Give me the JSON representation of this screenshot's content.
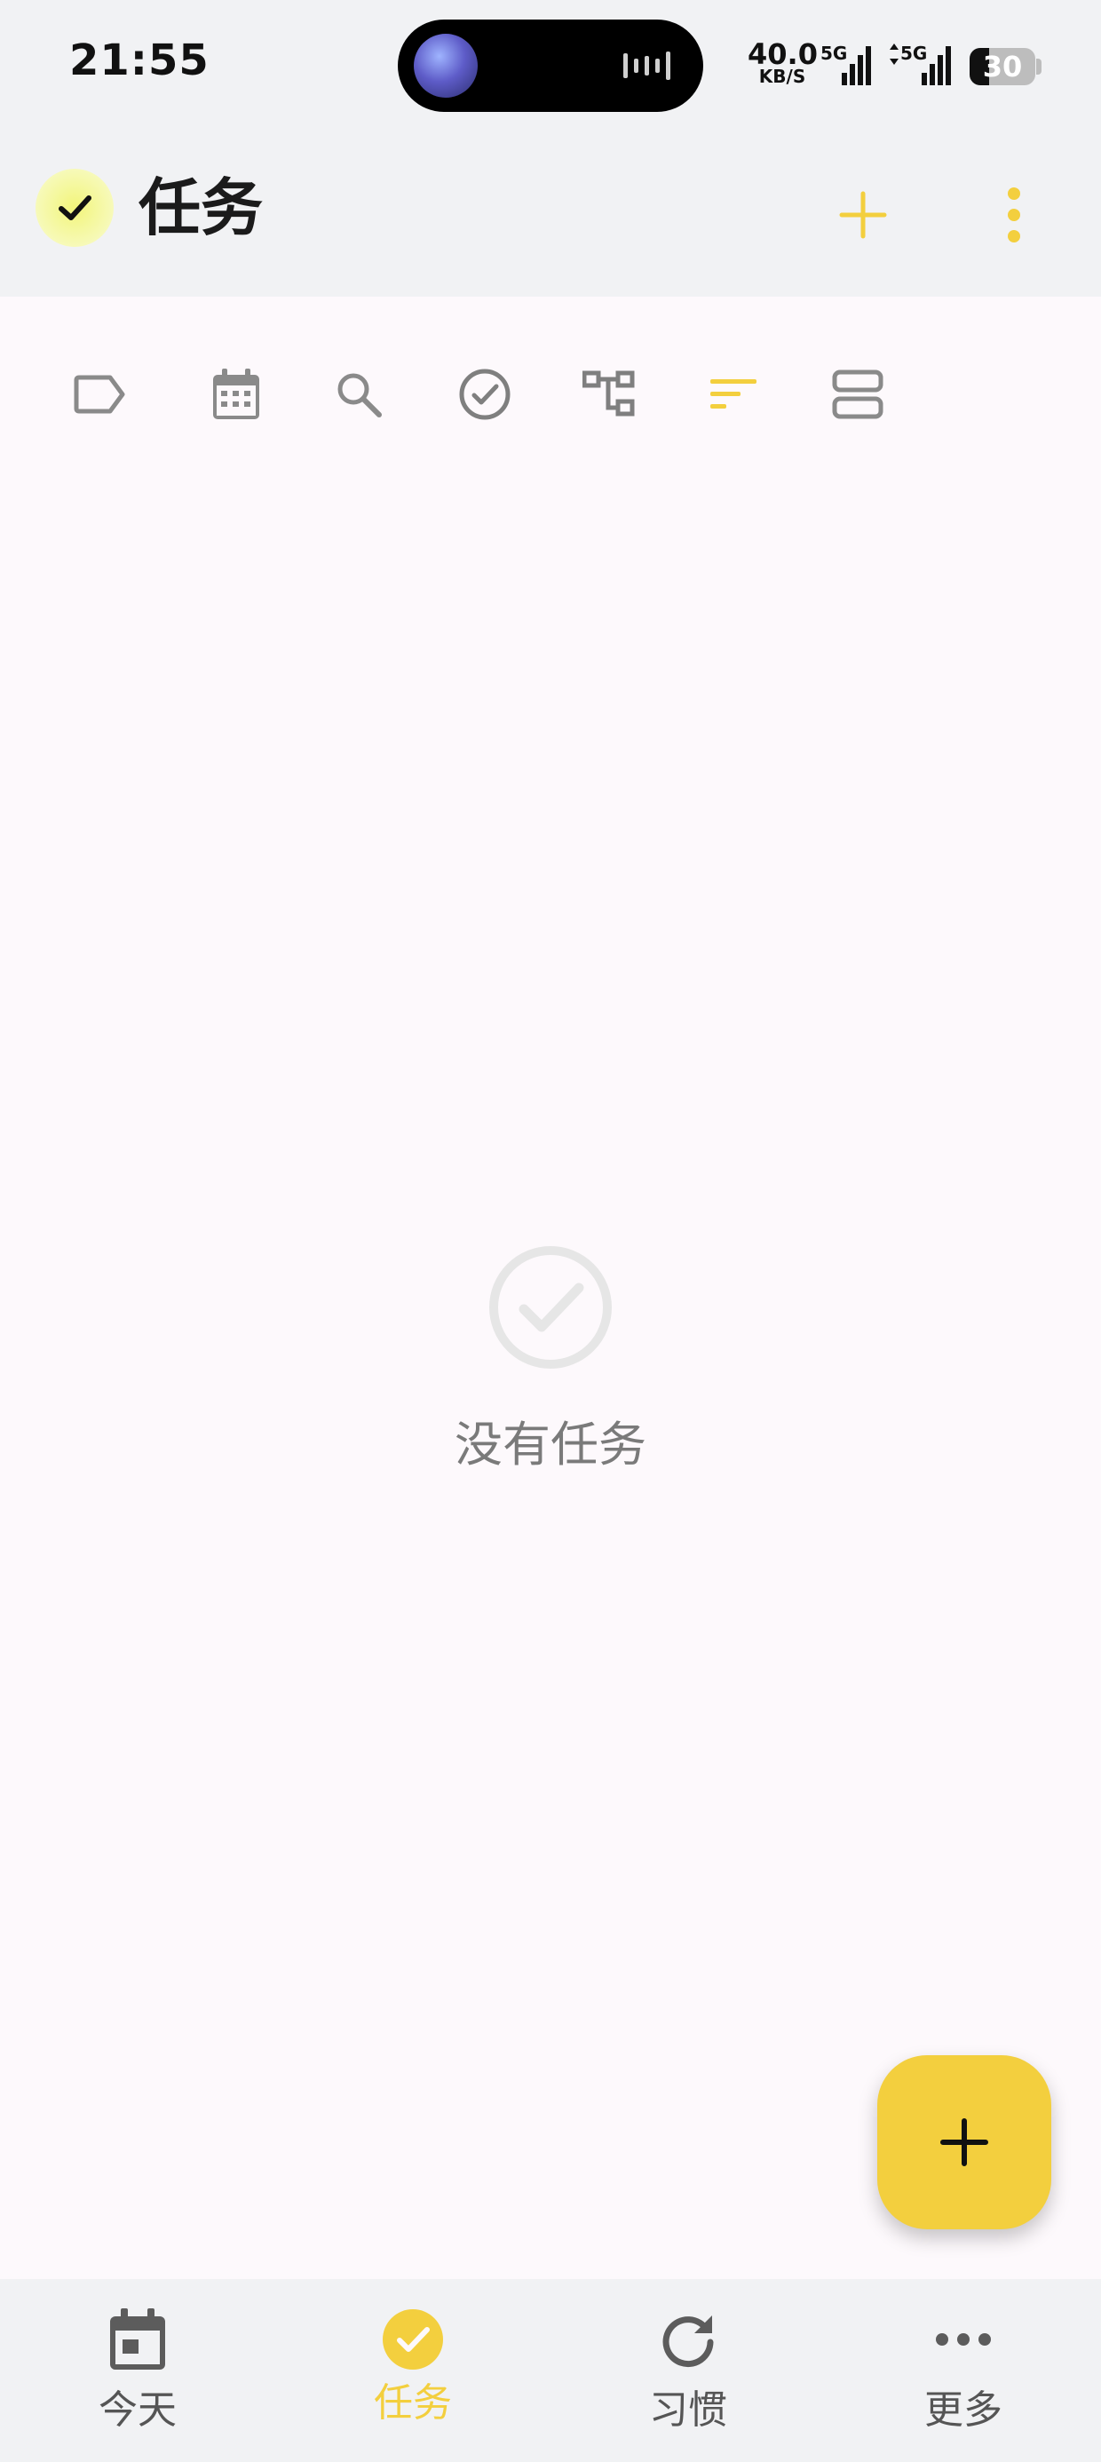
{
  "status_bar": {
    "time": "21:55",
    "net_speed_value": "40.0",
    "net_speed_unit": "KB/S",
    "sim1_label": "5G",
    "sim2_label": "5G",
    "battery_level": "30"
  },
  "app_bar": {
    "title": "任务",
    "add_icon": "plus-icon",
    "more_icon": "more-vertical-icon",
    "logo_icon": "check-icon"
  },
  "toolbar": {
    "tools": [
      {
        "name": "tag-filter",
        "icon": "tag-icon"
      },
      {
        "name": "date-filter",
        "icon": "calendar-icon"
      },
      {
        "name": "search",
        "icon": "search-icon"
      },
      {
        "name": "completed-toggle",
        "icon": "check-circle-icon"
      },
      {
        "name": "hierarchy",
        "icon": "hierarchy-icon"
      },
      {
        "name": "sort",
        "icon": "sort-icon",
        "active": true
      },
      {
        "name": "view-mode",
        "icon": "view-list-icon"
      }
    ]
  },
  "empty_state": {
    "message": "没有任务",
    "icon": "check-circle-icon"
  },
  "fab": {
    "icon": "plus-icon"
  },
  "bottom_nav": {
    "items": [
      {
        "label": "今天",
        "icon": "calendar-today-icon",
        "active": false
      },
      {
        "label": "任务",
        "icon": "check-circle-filled-icon",
        "active": true
      },
      {
        "label": "习惯",
        "icon": "refresh-icon",
        "active": false
      },
      {
        "label": "更多",
        "icon": "more-horizontal-icon",
        "active": false
      }
    ]
  },
  "colors": {
    "accent": "#f3cf3e",
    "background": "#fdf9fc",
    "bar_background": "#f1f2f4",
    "icon_gray": "#8a8a8a",
    "empty_icon": "#e6e6e6"
  }
}
